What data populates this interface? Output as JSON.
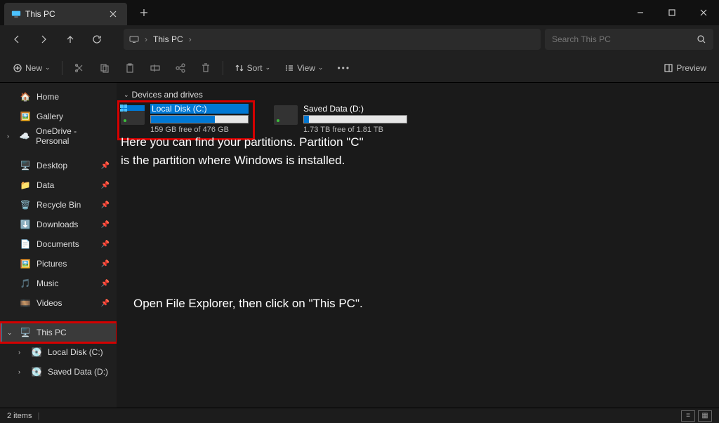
{
  "tab": {
    "title": "This PC"
  },
  "address": {
    "seg1": "This PC"
  },
  "search": {
    "placeholder": "Search This PC"
  },
  "toolbar": {
    "new": "New",
    "sort": "Sort",
    "view": "View",
    "preview": "Preview"
  },
  "sidebar": {
    "home": "Home",
    "gallery": "Gallery",
    "onedrive": "OneDrive - Personal",
    "desktop": "Desktop",
    "data": "Data",
    "recycle": "Recycle Bin",
    "downloads": "Downloads",
    "documents": "Documents",
    "pictures": "Pictures",
    "music": "Music",
    "videos": "Videos",
    "thispc": "This PC",
    "drive_c": "Local Disk (C:)",
    "drive_d": "Saved Data (D:)"
  },
  "group": {
    "header": "Devices and drives"
  },
  "drives": {
    "c": {
      "name": "Local Disk (C:)",
      "free": "159 GB free of 476 GB",
      "fill": 66
    },
    "d": {
      "name": "Saved Data (D:)",
      "free": "1.73 TB free of 1.81 TB",
      "fill": 5
    }
  },
  "annotations": {
    "a1": "Here you can find your partitions. Partition \"C\" is the partition where Windows is installed.",
    "a2": "Open File Explorer, then click on \"This PC\"."
  },
  "status": {
    "items": "2 items"
  }
}
